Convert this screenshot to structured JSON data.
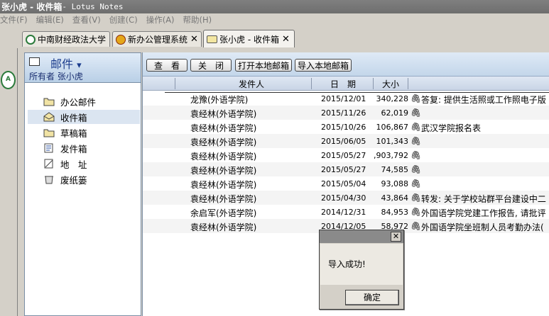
{
  "window": {
    "title": "张小虎 - 收件箱",
    "app_name": " - Lotus Notes"
  },
  "menu": [
    {
      "label": "文件(F)"
    },
    {
      "label": "编辑(E)"
    },
    {
      "label": "查看(V)"
    },
    {
      "label": "创建(C)"
    },
    {
      "label": "操作(A)"
    },
    {
      "label": "帮助(H)"
    }
  ],
  "tabs": [
    {
      "label": "中南财经政法大学",
      "icon": "globe-icon",
      "closable": false,
      "active": false
    },
    {
      "label": "新办公管理系统",
      "icon": "app-logo-icon",
      "closable": true,
      "active": false
    },
    {
      "label": "张小虎 - 收件箱",
      "icon": "mailbox-icon",
      "closable": true,
      "active": true
    }
  ],
  "nav": {
    "title": "邮件",
    "owner_label": "所有者 张小虎",
    "items": [
      {
        "label": "办公邮件",
        "icon": "folder-icon"
      },
      {
        "label": "收件箱",
        "icon": "inbox-icon",
        "selected": true
      },
      {
        "label": "草稿箱",
        "icon": "drafts-icon"
      },
      {
        "label": "发件箱",
        "icon": "outbox-icon"
      },
      {
        "label": "地　址",
        "icon": "address-book-icon"
      },
      {
        "label": "废纸篓",
        "icon": "trash-icon"
      }
    ]
  },
  "toolbar": {
    "view_label": "查　看",
    "close_label": "关　闭",
    "open_local_label": "打开本地邮箱",
    "import_local_label": "导入本地邮箱"
  },
  "columns": {
    "sender": "发件人",
    "date": "日　期",
    "size": "大小"
  },
  "messages": [
    {
      "sender": "龙豫(外语学院)",
      "date": "2015/12/01",
      "size": "340,228",
      "subject": "答复: 提供生活照或工作照电子版"
    },
    {
      "sender": "袁经林(外语学院)",
      "date": "2015/11/26",
      "size": "62,019",
      "subject": ""
    },
    {
      "sender": "袁经林(外语学院)",
      "date": "2015/10/26",
      "size": "106,867",
      "subject": "武汉学院报名表"
    },
    {
      "sender": "袁经林(外语学院)",
      "date": "2015/06/05",
      "size": "101,343",
      "subject": ""
    },
    {
      "sender": "袁经林(外语学院)",
      "date": "2015/05/27",
      "size": ",903,792",
      "subject": ""
    },
    {
      "sender": "袁经林(外语学院)",
      "date": "2015/05/27",
      "size": "74,585",
      "subject": ""
    },
    {
      "sender": "袁经林(外语学院)",
      "date": "2015/05/04",
      "size": "93,088",
      "subject": ""
    },
    {
      "sender": "袁经林(外语学院)",
      "date": "2015/04/30",
      "size": "43,864",
      "subject": "转发: 关于学校站群平台建设中二"
    },
    {
      "sender": "余启军(外语学院)",
      "date": "2014/12/31",
      "size": "84,953",
      "subject": "外国语学院党建工作报告, 请批评"
    },
    {
      "sender": "袁经林(外语学院)",
      "date": "2014/12/05",
      "size": "58,972",
      "subject": "外国语学院坐班制人员考勤办法("
    }
  ],
  "dialog": {
    "message": "导入成功!",
    "ok_label": "确定",
    "close_glyph": "✕"
  },
  "glyphs": {
    "attachment": "🖇",
    "close": "✕",
    "dropdown": "▾"
  },
  "colors": {
    "accent_blue": "#1a3b8c",
    "nav_header": "#b9cfe6",
    "title_bar": "#7f7f7f"
  }
}
